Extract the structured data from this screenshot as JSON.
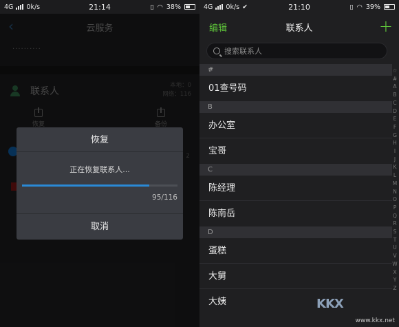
{
  "left": {
    "status": {
      "network": "4G",
      "speed": "0k/s",
      "time": "21:14",
      "battery": "38%"
    },
    "nav": {
      "back": "‹",
      "title": "云服务"
    },
    "account": "··········",
    "contacts_label": "联系人",
    "counts": {
      "local": "本地：0",
      "cloud": "网络：116"
    },
    "actions": {
      "restore": "恢复",
      "backup": "备份"
    },
    "side_number": "2",
    "dialog": {
      "title": "恢复",
      "message": "正在恢复联系人...",
      "progress": 0.819,
      "count": "95/116",
      "cancel": "取消"
    }
  },
  "right": {
    "status": {
      "network": "4G",
      "speed": "0k/s",
      "time": "21:10",
      "battery": "39%"
    },
    "nav": {
      "edit": "编辑",
      "title": "联系人",
      "add": "+"
    },
    "search": {
      "placeholder": "搜索联系人"
    },
    "sections": [
      {
        "header": "#",
        "contacts": [
          "01查号码"
        ]
      },
      {
        "header": "B",
        "contacts": [
          "办公室",
          "宝哥"
        ]
      },
      {
        "header": "C",
        "contacts": [
          "陈经理",
          "陈南岳"
        ]
      },
      {
        "header": "D",
        "contacts": [
          "蛋糕",
          "大舅",
          "大姨"
        ]
      }
    ],
    "index": [
      "☆",
      "#",
      "A",
      "B",
      "C",
      "D",
      "E",
      "F",
      "G",
      "H",
      "I",
      "J",
      "K",
      "L",
      "M",
      "N",
      "O",
      "P",
      "Q",
      "R",
      "S",
      "T",
      "U",
      "V",
      "W",
      "X",
      "Y",
      "Z"
    ]
  },
  "watermark": {
    "logo": "KKX",
    "url": "www.kkx.net"
  },
  "colors": {
    "accent_green": "#5ec43a",
    "progress_blue": "#2a8ad6",
    "dialog_bg": "#3a3c42"
  }
}
